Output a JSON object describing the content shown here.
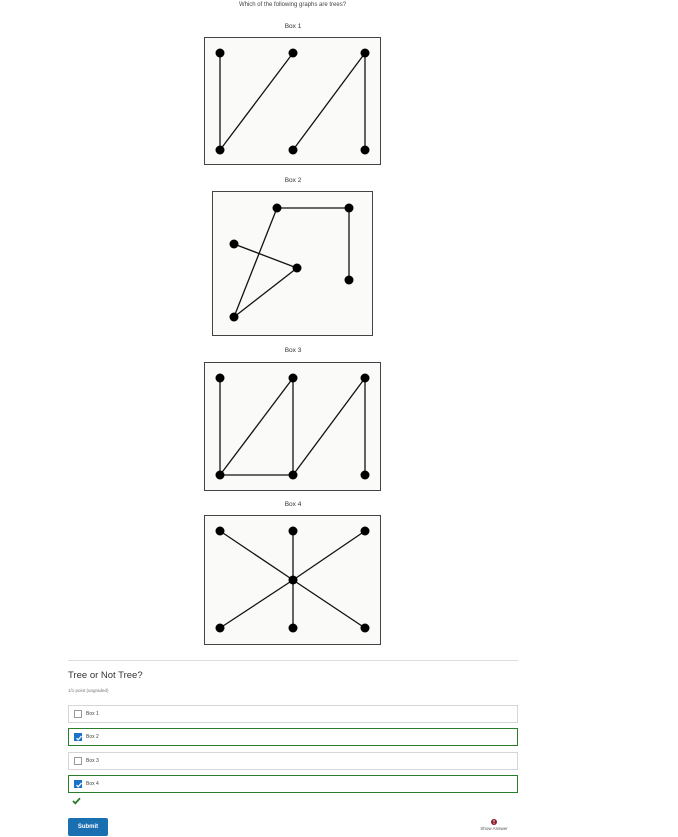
{
  "question": {
    "prompt": "Which of the following graphs are trees?"
  },
  "boxes": [
    {
      "label": "Box 1"
    },
    {
      "label": "Box 2"
    },
    {
      "label": "Box 3"
    },
    {
      "label": "Box 4"
    }
  ],
  "problem": {
    "title": "Tree or Not Tree?",
    "points": "1/1 point (ungraded)",
    "options": [
      {
        "label": "Box 1",
        "checked": false
      },
      {
        "label": "Box 2",
        "checked": true
      },
      {
        "label": "Box 3",
        "checked": false
      },
      {
        "label": "Box 4",
        "checked": true
      }
    ],
    "submit_label": "Submit",
    "show_answer_label": "Show Answer"
  },
  "colors": {
    "correct": "#2a7d2a",
    "accent": "#1a6fb0",
    "show_answer_icon": "#8b1a2b"
  },
  "icons": {
    "status": "check-icon",
    "show_answer": "info-icon"
  }
}
